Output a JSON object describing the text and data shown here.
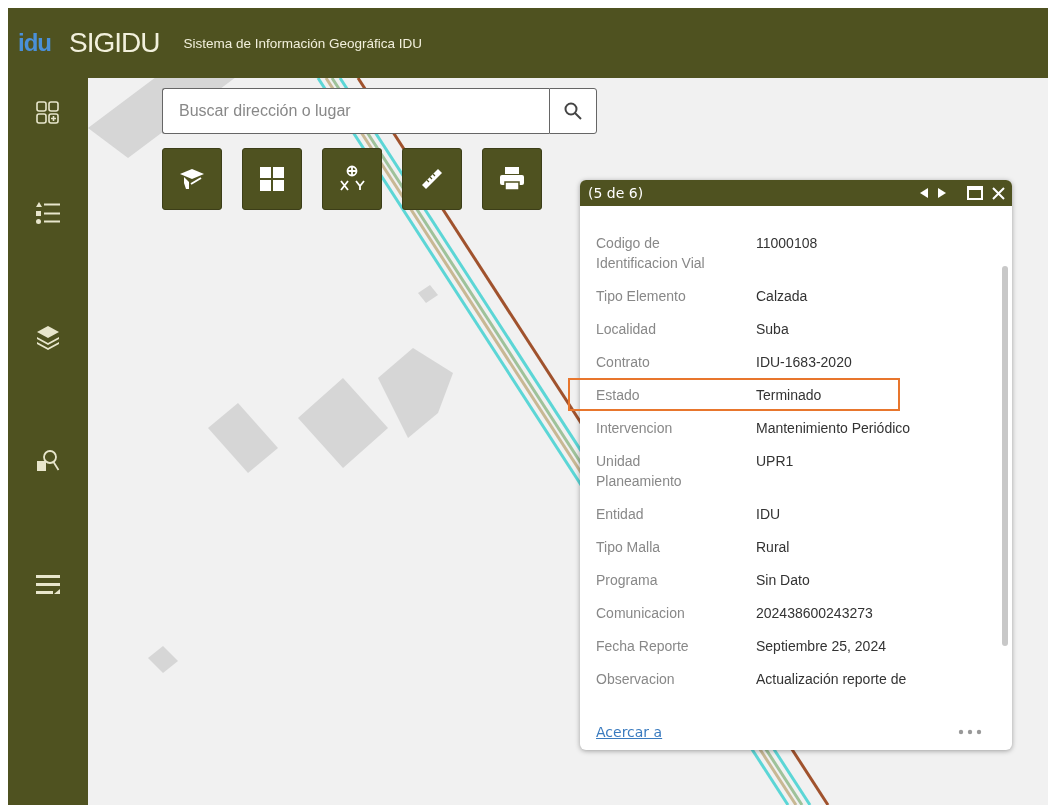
{
  "header": {
    "logo": "idu",
    "title": "SIGIDU",
    "subtitle": "Sistema de Información Geográfica IDU"
  },
  "sidebar": {
    "items": [
      {
        "kind": "widgets"
      },
      {
        "kind": "legend"
      },
      {
        "kind": "layers"
      },
      {
        "kind": "query"
      },
      {
        "kind": "list"
      }
    ]
  },
  "search": {
    "placeholder": "Buscar dirección o lugar"
  },
  "toolbar": [
    {
      "kind": "learn"
    },
    {
      "kind": "basemap"
    },
    {
      "kind": "coordinates"
    },
    {
      "kind": "measure"
    },
    {
      "kind": "print"
    }
  ],
  "popup": {
    "counter": "(5 de 6)",
    "rows": [
      {
        "label": "Codigo de Identificacion Vial",
        "value": "11000108",
        "highlighted": false
      },
      {
        "label": "Tipo Elemento",
        "value": "Calzada",
        "highlighted": false
      },
      {
        "label": "Localidad",
        "value": "Suba",
        "highlighted": false
      },
      {
        "label": "Contrato",
        "value": "IDU-1683-2020",
        "highlighted": false
      },
      {
        "label": "Estado",
        "value": "Terminado",
        "highlighted": true
      },
      {
        "label": "Intervencion",
        "value": "Mantenimiento Periódico",
        "highlighted": false
      },
      {
        "label": "Unidad Planeamiento",
        "value": "UPR1",
        "highlighted": false
      },
      {
        "label": "Entidad",
        "value": "IDU",
        "highlighted": false
      },
      {
        "label": "Tipo Malla",
        "value": "Rural",
        "highlighted": false
      },
      {
        "label": "Programa",
        "value": "Sin Dato",
        "highlighted": false
      },
      {
        "label": "Comunicacion",
        "value": "202438600243273",
        "highlighted": false
      },
      {
        "label": "Fecha Reporte",
        "value": "Septiembre 25, 2024",
        "highlighted": false
      },
      {
        "label": "Observacion",
        "value": "Actualización reporte de",
        "highlighted": false
      }
    ],
    "zoom_link": "Acercar a"
  }
}
